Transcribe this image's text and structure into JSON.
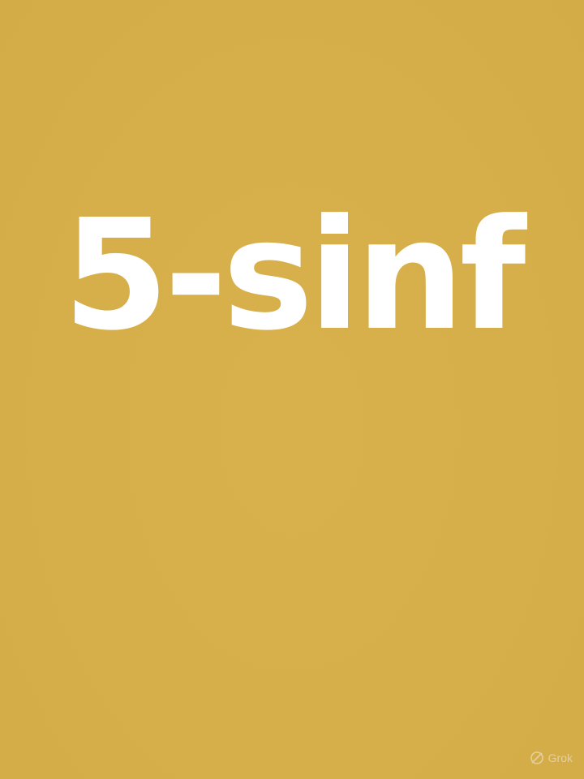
{
  "background_color": "#D6AE4A",
  "text_color": "#FFFFFF",
  "headline": "5-sinf",
  "watermark": {
    "icon": "grok-logo-icon",
    "label": "Grok"
  }
}
